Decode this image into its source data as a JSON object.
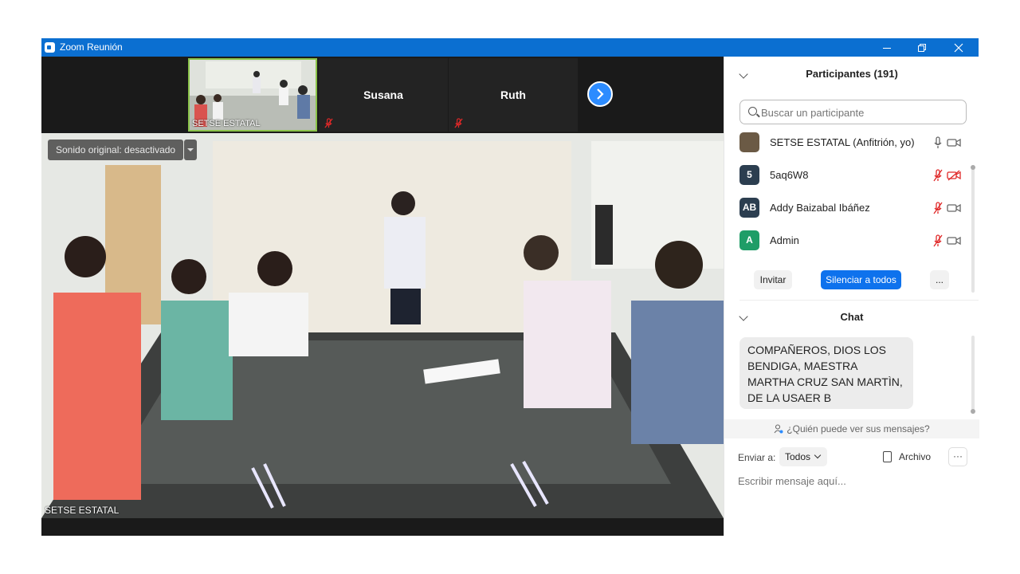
{
  "window": {
    "title": "Zoom Reunión"
  },
  "video": {
    "thumbnails": [
      {
        "name": "SETSE ESTATAL",
        "type": "video",
        "active": true
      },
      {
        "name": "Susana",
        "type": "name-only",
        "muted": true
      },
      {
        "name": "Ruth",
        "type": "name-only",
        "muted": true
      }
    ],
    "original_sound_label": "Sonido original: desactivado",
    "main_speaker_label": "SETSE ESTATAL"
  },
  "participants": {
    "title": "Participantes (191)",
    "search_placeholder": "Buscar un participante",
    "list": [
      {
        "initials": "",
        "name": "SETSE ESTATAL (Anfitrión, yo)",
        "avatar_color": "#6b5a45",
        "mic": "on",
        "video": "on"
      },
      {
        "initials": "5",
        "name": "5aq6W8",
        "avatar_color": "#2c3e50",
        "mic": "muted",
        "video": "off"
      },
      {
        "initials": "AB",
        "name": "Addy Baizabal Ibáñez",
        "avatar_color": "#2c3e50",
        "mic": "muted",
        "video": "on"
      },
      {
        "initials": "A",
        "name": "Admin",
        "avatar_color": "#1f9d67",
        "mic": "muted",
        "video": "on"
      }
    ],
    "buttons": {
      "invite": "Invitar",
      "mute_all": "Silenciar a todos",
      "more": "..."
    }
  },
  "chat": {
    "title": "Chat",
    "messages": [
      {
        "text": "COMPAÑEROS, DIOS LOS BENDIGA, MAESTRA MARTHA CRUZ SAN MARTÌN, DE LA USAER B"
      }
    ],
    "who_can_see": "¿Quién puede ver sus mensajes?",
    "send_to_label": "Enviar a:",
    "send_to_value": "Todos",
    "file_label": "Archivo",
    "more": "···",
    "input_placeholder": "Escribir mensaje aquí..."
  },
  "colors": {
    "titlebar": "#0b6fd1",
    "accent_blue": "#2d8cff",
    "muted_red": "#e02828",
    "active_border": "#8bc34a"
  }
}
